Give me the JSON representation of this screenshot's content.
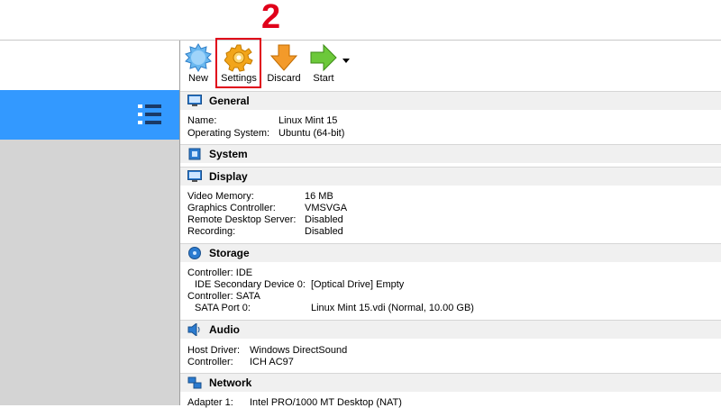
{
  "annotation": {
    "step": "2"
  },
  "toolbar": {
    "new": "New",
    "settings": "Settings",
    "discard": "Discard",
    "start": "Start"
  },
  "sections": {
    "general": {
      "title": "General",
      "rows": [
        {
          "label": "Name:",
          "value": "Linux Mint 15"
        },
        {
          "label": "Operating System:",
          "value": "Ubuntu (64-bit)"
        }
      ]
    },
    "system": {
      "title": "System"
    },
    "display": {
      "title": "Display",
      "rows": [
        {
          "label": "Video Memory:",
          "value": "16 MB"
        },
        {
          "label": "Graphics Controller:",
          "value": "VMSVGA"
        },
        {
          "label": "Remote Desktop Server:",
          "value": "Disabled"
        },
        {
          "label": "Recording:",
          "value": "Disabled"
        }
      ]
    },
    "storage": {
      "title": "Storage",
      "rows": [
        {
          "label": "Controller: IDE",
          "value": ""
        },
        {
          "label": "IDE Secondary Device 0:",
          "value": "[Optical Drive] Empty"
        },
        {
          "label": "Controller: SATA",
          "value": ""
        },
        {
          "label": "SATA Port 0:",
          "value": "Linux Mint 15.vdi (Normal, 10.00 GB)"
        }
      ]
    },
    "audio": {
      "title": "Audio",
      "rows": [
        {
          "label": "Host Driver:",
          "value": "Windows DirectSound"
        },
        {
          "label": "Controller:",
          "value": "ICH AC97"
        }
      ]
    },
    "network": {
      "title": "Network",
      "rows": [
        {
          "label": "Adapter 1:",
          "value": "Intel PRO/1000 MT Desktop (NAT)"
        }
      ]
    }
  },
  "colors": {
    "selection": "#3399ff",
    "highlight": "#e0001a",
    "header_bg": "#f0f0f0"
  }
}
